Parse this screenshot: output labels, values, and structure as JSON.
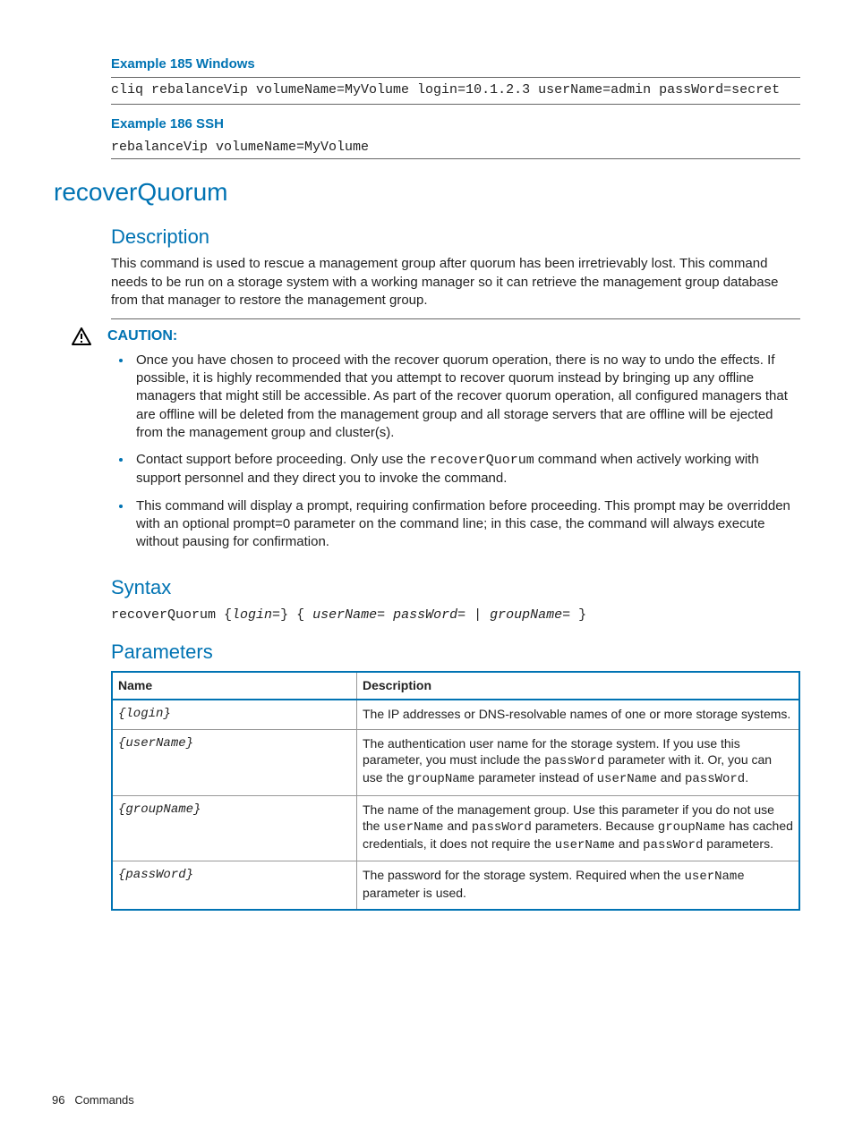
{
  "example185": {
    "title": "Example 185 Windows",
    "code": "cliq rebalanceVip volumeName=MyVolume login=10.1.2.3 userName=admin passWord=secret"
  },
  "example186": {
    "title": "Example 186 SSH",
    "code": "rebalanceVip volumeName=MyVolume"
  },
  "command": {
    "name": "recoverQuorum",
    "descriptionHeading": "Description",
    "descriptionBody": "This command is used to rescue a management group after quorum has been irretrievably lost. This command needs to be run on a storage system with a working manager so it can retrieve the management group database from that manager to restore the management group.",
    "caution": {
      "label": "CAUTION:",
      "items": [
        "Once you have chosen to proceed with the recover quorum operation, there is no way to undo the effects. If possible, it is highly recommended that you attempt to recover quorum instead by bringing up any offline managers that might still be accessible. As part of the recover quorum operation, all configured managers that are offline will be deleted from the management group and all storage servers that are offline will be ejected from the management group and cluster(s).",
        "Contact support before proceeding. Only use the recoverQuorum command when actively working with support personnel and they direct you to invoke the command.",
        "This command will display a prompt, requiring confirmation before proceeding. This prompt may be overridden with an optional prompt=0 parameter on the command line; in this case, the command will always execute without pausing for confirmation."
      ]
    },
    "syntaxHeading": "Syntax",
    "syntaxParts": {
      "cmd": "recoverQuorum",
      "p1": "login=",
      "p2": "userName= passWord=",
      "sep": " | ",
      "p3": "groupName="
    },
    "parametersHeading": "Parameters",
    "paramsHeader": {
      "name": "Name",
      "desc": "Description"
    },
    "params": [
      {
        "name": "login",
        "desc": "The IP addresses or DNS-resolvable names of one or more storage systems."
      },
      {
        "name": "userName",
        "desc": "The authentication user name for the storage system. If you use this parameter, you must include the passWord parameter with it. Or, you can use the groupName parameter instead of userName and passWord."
      },
      {
        "name": "groupName",
        "desc": "The name of the management group. Use this parameter if you do not use the userName and passWord parameters. Because groupName has cached credentials, it does not require the userName and passWord parameters."
      },
      {
        "name": "passWord",
        "desc": "The password for the storage system. Required when the userName parameter is used."
      }
    ]
  },
  "footer": {
    "page": "96",
    "section": "Commands"
  }
}
